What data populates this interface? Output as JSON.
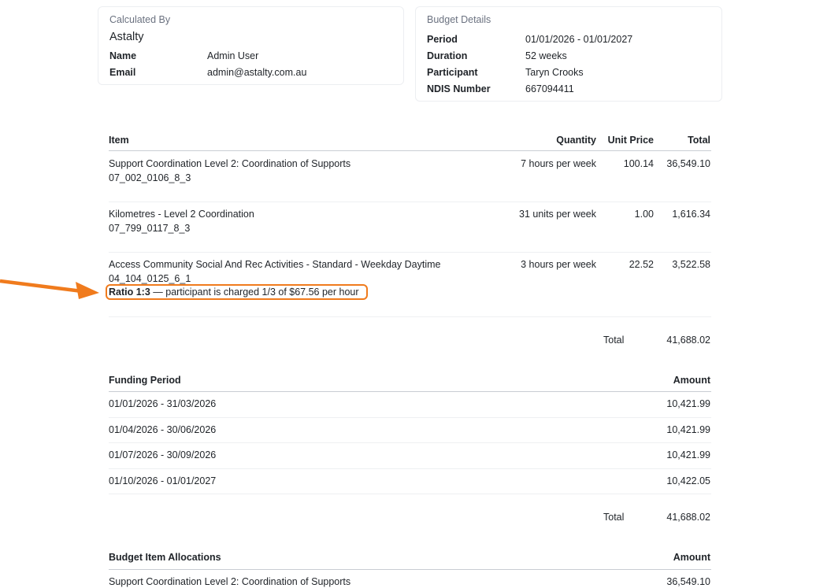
{
  "calculated_by": {
    "title": "Calculated By",
    "company": "Astalty",
    "fields": [
      {
        "label": "Name",
        "value": "Admin User"
      },
      {
        "label": "Email",
        "value": "admin@astalty.com.au"
      }
    ]
  },
  "budget_details": {
    "title": "Budget Details",
    "fields": [
      {
        "label": "Period",
        "value": "01/01/2026 - 01/01/2027"
      },
      {
        "label": "Duration",
        "value": "52 weeks"
      },
      {
        "label": "Participant",
        "value": "Taryn Crooks"
      },
      {
        "label": "NDIS Number",
        "value": "667094411"
      }
    ]
  },
  "items_table": {
    "headers": {
      "item": "Item",
      "quantity": "Quantity",
      "unit_price": "Unit Price",
      "total": "Total"
    },
    "rows": [
      {
        "name": "Support Coordination Level 2: Coordination of Supports",
        "code": "07_002_0106_8_3",
        "quantity": "7 hours per week",
        "unit_price": "100.14",
        "total": "36,549.10"
      },
      {
        "name": "Kilometres - Level 2 Coordination",
        "code": "07_799_0117_8_3",
        "quantity": "31 units per week",
        "unit_price": "1.00",
        "total": "1,616.34"
      },
      {
        "name": "Access Community Social And Rec Activities - Standard - Weekday Daytime",
        "code": "04_104_0125_6_1",
        "quantity": "3 hours per week",
        "unit_price": "22.52",
        "total": "3,522.58",
        "ratio_label": "Ratio 1:3",
        "ratio_note": " — participant is charged 1/3 of $67.56 per hour"
      }
    ],
    "total_label": "Total",
    "total_value": "41,688.02"
  },
  "funding_table": {
    "headers": {
      "period": "Funding Period",
      "amount": "Amount"
    },
    "rows": [
      {
        "period": "01/01/2026 - 31/03/2026",
        "amount": "10,421.99"
      },
      {
        "period": "01/04/2026 - 30/06/2026",
        "amount": "10,421.99"
      },
      {
        "period": "01/07/2026 - 30/09/2026",
        "amount": "10,421.99"
      },
      {
        "period": "01/10/2026 - 01/01/2027",
        "amount": "10,422.05"
      }
    ],
    "total_label": "Total",
    "total_value": "41,688.02"
  },
  "allocations_table": {
    "headers": {
      "item": "Budget Item Allocations",
      "amount": "Amount"
    },
    "rows": [
      {
        "item": "Support Coordination Level 2: Coordination of Supports",
        "amount": "36,549.10"
      }
    ]
  },
  "annotation": {
    "arrow_color": "#f07b1d",
    "box_color": "#f07b1d"
  }
}
